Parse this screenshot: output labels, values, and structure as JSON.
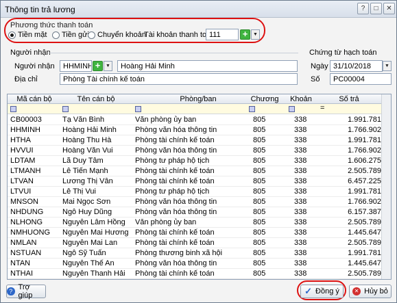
{
  "window": {
    "title": "Thông tin trả lương"
  },
  "payment": {
    "group_label": "Phương thức thanh toán",
    "options": [
      "Tiền mặt",
      "Tiền gửi",
      "Chuyển khoản"
    ],
    "account_label": "Tài khoản thanh toán",
    "account_value": "111"
  },
  "recipient": {
    "section": "Người nhận",
    "code_label": "Người nhận",
    "code_value": "HHMINH",
    "name_value": "Hoàng Hải Minh",
    "address_label": "Địa chỉ",
    "address_value": "Phòng Tài chính kế toán"
  },
  "voucher": {
    "section": "Chứng từ hạch toán",
    "date_label": "Ngày",
    "date_value": "31/10/2018",
    "number_label": "Số",
    "number_value": "PC00004"
  },
  "table": {
    "columns": [
      "Mã cán bộ",
      "Tên cán bộ",
      "Phòng/ban",
      "Chương",
      "Khoản",
      "Số trả"
    ],
    "rows": [
      [
        "CB00003",
        "Tạ Văn Bình",
        "Văn phòng ủy ban",
        "805",
        "338",
        "1.991.781"
      ],
      [
        "HHMINH",
        "Hoàng Hải Minh",
        "Phòng văn hóa thông tin",
        "805",
        "338",
        "1.766.902"
      ],
      [
        "HTHA",
        "Hoàng Thu Hà",
        "Phòng tài chính kế toán",
        "805",
        "338",
        "1.991.781"
      ],
      [
        "HVVUI",
        "Hoàng Văn Vui",
        "Phòng văn hóa thông tin",
        "805",
        "338",
        "1.766.902"
      ],
      [
        "LDTAM",
        "Lã Duy Tâm",
        "Phòng tư pháp hộ tịch",
        "805",
        "338",
        "1.606.275"
      ],
      [
        "LTMANH",
        "Lê Tiến Mạnh",
        "Phòng tài chính kế toán",
        "805",
        "338",
        "2.505.789"
      ],
      [
        "LTVAN",
        "Lương Thị Vân",
        "Phòng tài chính kế toán",
        "805",
        "338",
        "6.457.225"
      ],
      [
        "LTVUI",
        "Lê Thị Vui",
        "Phòng tư pháp hộ tịch",
        "805",
        "338",
        "1.991.781"
      ],
      [
        "MNSON",
        "Mai Ngọc Sơn",
        "Phòng văn hóa thông tin",
        "805",
        "338",
        "1.766.902"
      ],
      [
        "NHDUNG",
        "Ngô Huy Dũng",
        "Phòng văn hóa thông tin",
        "805",
        "338",
        "6.157.387"
      ],
      [
        "NLHONG",
        "Nguyễn Lâm Hồng",
        "Văn phòng ủy ban",
        "805",
        "338",
        "2.505.789"
      ],
      [
        "NMHUONG",
        "Nguyễn Mai Hương",
        "Phòng tài chính kế toán",
        "805",
        "338",
        "1.445.647"
      ],
      [
        "NMLAN",
        "Nguyễn Mai Lan",
        "Phòng tài chính kế toán",
        "805",
        "338",
        "2.505.789"
      ],
      [
        "NSTUAN",
        "Ngô Sỹ Tuấn",
        "Phòng thương binh xã hội",
        "805",
        "338",
        "1.991.781"
      ],
      [
        "NTAN",
        "Nguyễn Thế An",
        "Phòng văn hóa thông tin",
        "805",
        "338",
        "1.445.647"
      ],
      [
        "NTHAI",
        "Nguyễn Thanh Hải",
        "Phòng tài chính kế toán",
        "805",
        "338",
        "2.505.789"
      ]
    ],
    "filter_eq": "="
  },
  "buttons": {
    "help": "Trợ giúp",
    "ok": "Đồng ý",
    "cancel": "Hủy bỏ"
  },
  "colors": {
    "highlight_oval": "#dd1111",
    "plus_green": "#3fb43f"
  }
}
